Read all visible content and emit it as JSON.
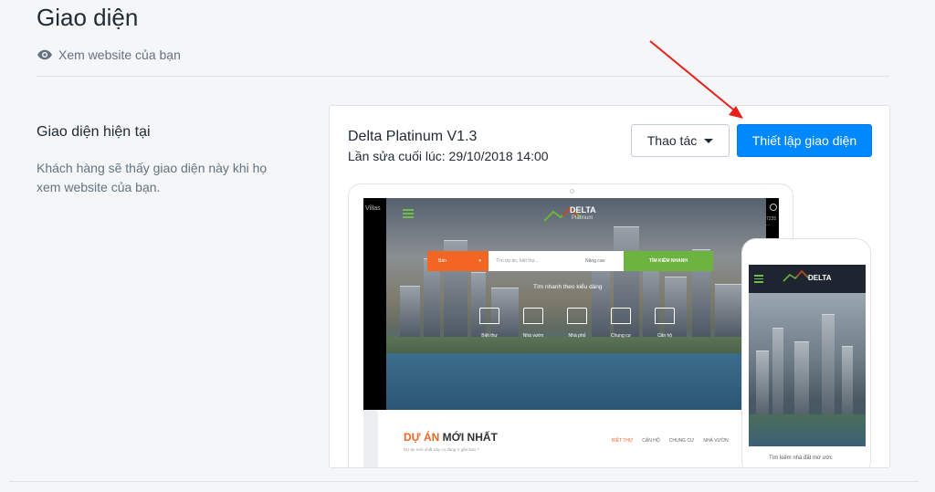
{
  "header": {
    "title": "Giao diện",
    "view_site_label": "Xem website của bạn"
  },
  "section": {
    "heading": "Giao diện hiện tại",
    "description": "Khách hàng sẽ thấy giao diện này khi họ xem website của bạn."
  },
  "theme": {
    "name": "Delta Platinum V1.3",
    "last_edited": "Lần sửa cuối lúc: 29/10/2018 14:00",
    "actions_label": "Thao tác",
    "setup_label": "Thiết lập giao diện"
  },
  "preview": {
    "side_text": "Villas",
    "logo_name": "DELTA",
    "logo_sub": "Platinum",
    "right_strip_text": "7235 ...",
    "search_select": "Bán",
    "search_placeholder": "Tìm dự án, biệt thự...",
    "search_advanced": "Nâng cao",
    "search_button": "TÌM KIẾM NHANH",
    "quick_title": "Tìm nhanh theo kiểu dáng",
    "categories": [
      "Biệt thự",
      "Nhà vườn",
      "Nhà phố",
      "Chung cư",
      "Căn hộ"
    ],
    "projects_title_highlight": "DỰ ÁN",
    "projects_title_rest": " MỚI NHẤT",
    "projects_sub": "Dự án mới nhất này có đang ở gần bạn ?",
    "project_tabs": [
      "BIỆT THỰ",
      "CĂN HỘ",
      "CHUNG CƯ",
      "NHÀ VƯỜN"
    ],
    "phone_search_title": "Tìm kiếm nhà đất mơ ước"
  },
  "colors": {
    "primary": "#0088ff",
    "accent_orange": "#f26522",
    "accent_green": "#6cb33f",
    "arrow": "#e8211b"
  }
}
